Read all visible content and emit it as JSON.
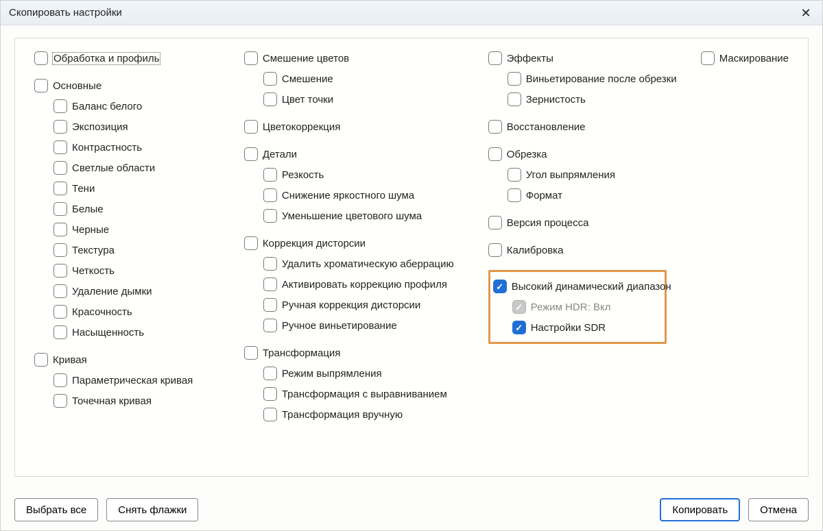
{
  "window": {
    "title": "Скопировать настройки"
  },
  "col1": {
    "treatment": {
      "label": "Обработка и профиль"
    },
    "basic": {
      "label": "Основные",
      "wb": "Баланс белого",
      "exposure": "Экспозиция",
      "contrast": "Контрастность",
      "highlights": "Светлые области",
      "shadows": "Тени",
      "whites": "Белые",
      "blacks": "Черные",
      "texture": "Текстура",
      "clarity": "Четкость",
      "dehaze": "Удаление дымки",
      "vibrance": "Красочность",
      "saturation": "Насыщенность"
    },
    "curve": {
      "label": "Кривая",
      "parametric": "Параметрическая кривая",
      "point": "Точечная кривая"
    }
  },
  "col2": {
    "colormix": {
      "label": "Смешение цветов",
      "mix": "Смешение",
      "pointcolor": "Цвет точки"
    },
    "colorgrading": {
      "label": "Цветокоррекция"
    },
    "detail": {
      "label": "Детали",
      "sharp": "Резкость",
      "luminance_nr": "Снижение яркостного шума",
      "color_nr": "Уменьшение цветового шума"
    },
    "lens": {
      "label": "Коррекция дисторсии",
      "ca": "Удалить хроматическую аберрацию",
      "profile": "Активировать коррекцию профиля",
      "manual_dist": "Ручная коррекция дисторсии",
      "manual_vig": "Ручное виньетирование"
    },
    "transform": {
      "label": "Трансформация",
      "upright": "Режим выпрямления",
      "upright_transforms": "Трансформация с выравниванием",
      "manual_transforms": "Трансформация вручную"
    }
  },
  "col3": {
    "effects": {
      "label": "Эффекты",
      "vignette": "Виньетирование после обрезки",
      "grain": "Зернистость"
    },
    "healing": {
      "label": "Восстановление"
    },
    "crop": {
      "label": "Обрезка",
      "angle": "Угол выпрямления",
      "aspect": "Формат"
    },
    "pv": {
      "label": "Версия процесса"
    },
    "calibration": {
      "label": "Калибровка"
    },
    "hdr": {
      "label": "Высокий динамический диапазон",
      "mode": "Режим HDR: Вкл",
      "sdr": "Настройки SDR"
    }
  },
  "col4": {
    "masking": {
      "label": "Маскирование"
    }
  },
  "footer": {
    "select_all": "Выбрать все",
    "select_none": "Снять флажки",
    "copy": "Копировать",
    "cancel": "Отмена"
  }
}
